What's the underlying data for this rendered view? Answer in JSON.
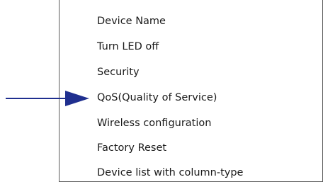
{
  "menu": {
    "items": [
      {
        "label": "Device Name"
      },
      {
        "label": "Turn LED off"
      },
      {
        "label": "Security"
      },
      {
        "label": "QoS(Quality of Service)",
        "highlighted_by_arrow": true
      },
      {
        "label": "Wireless configuration"
      },
      {
        "label": "Factory Reset"
      },
      {
        "label": "Device list with column-type"
      }
    ]
  },
  "callout": {
    "arrow_color": "#1f2f8f",
    "icon": "right-arrow-icon"
  },
  "colors": {
    "menu_border": "#5a5a5a",
    "text": "#1a1a1a",
    "background": "#ffffff"
  }
}
